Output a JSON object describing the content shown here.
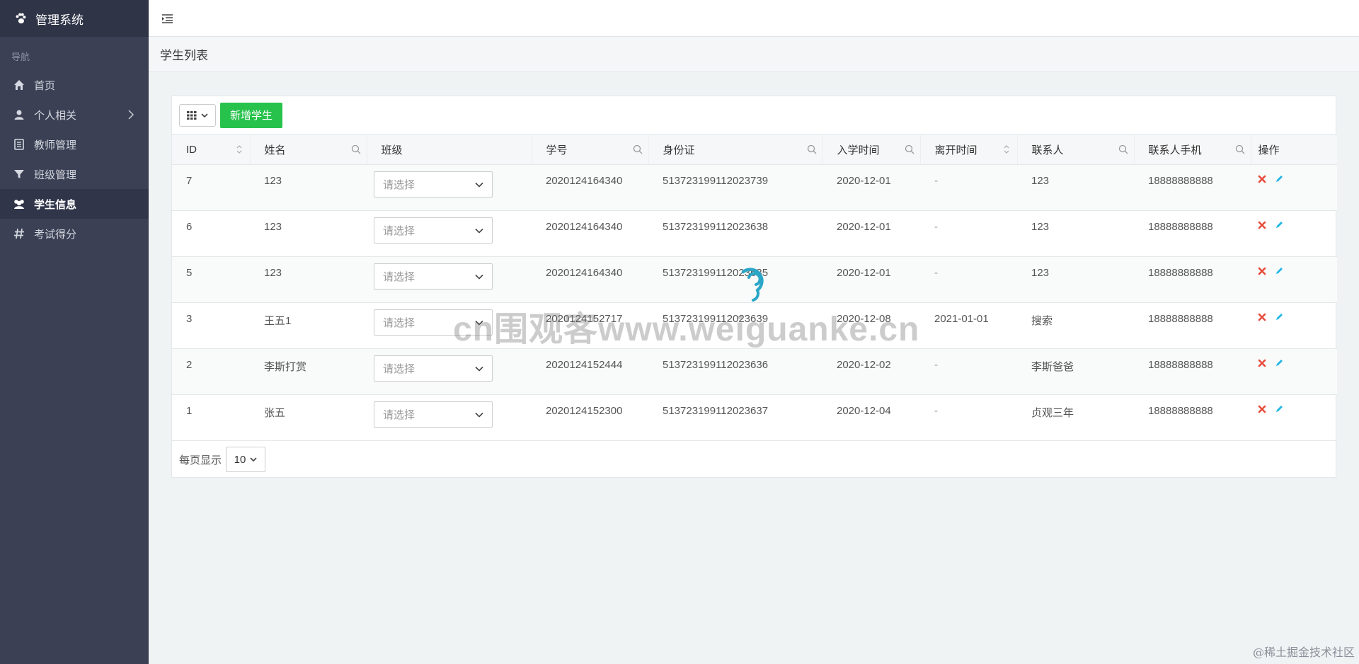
{
  "sidebar": {
    "brand": "管理系统",
    "caption": "导航",
    "items": [
      {
        "label": "首页",
        "icon": "home-icon"
      },
      {
        "label": "个人相关",
        "icon": "user-icon",
        "has_children": true
      },
      {
        "label": "教师管理",
        "icon": "book-icon"
      },
      {
        "label": "班级管理",
        "icon": "filter-icon"
      },
      {
        "label": "学生信息",
        "icon": "users-icon",
        "active": true
      },
      {
        "label": "考试得分",
        "icon": "hash-icon"
      }
    ]
  },
  "page": {
    "title": "学生列表"
  },
  "toolbar": {
    "add_label": "新增学生"
  },
  "table": {
    "columns": [
      "ID",
      "姓名",
      "班级",
      "学号",
      "身份证",
      "入学时间",
      "离开时间",
      "联系人",
      "联系人手机",
      "操作"
    ],
    "select_placeholder": "请选择",
    "rows": [
      {
        "id": "7",
        "name": "123",
        "student_no": "2020124164340",
        "id_card": "513723199112023739",
        "enroll": "2020-12-01",
        "leave": "-",
        "contact": "123",
        "phone": "18888888888"
      },
      {
        "id": "6",
        "name": "123",
        "student_no": "2020124164340",
        "id_card": "513723199112023638",
        "enroll": "2020-12-01",
        "leave": "-",
        "contact": "123",
        "phone": "18888888888"
      },
      {
        "id": "5",
        "name": "123",
        "student_no": "2020124164340",
        "id_card": "513723199112023635",
        "enroll": "2020-12-01",
        "leave": "-",
        "contact": "123",
        "phone": "18888888888"
      },
      {
        "id": "3",
        "name": "王五1",
        "student_no": "2020124152717",
        "id_card": "513723199112023639",
        "enroll": "2020-12-08",
        "leave": "2021-01-01",
        "contact": "搜索",
        "phone": "18888888888"
      },
      {
        "id": "2",
        "name": "李斯打赏",
        "student_no": "2020124152444",
        "id_card": "513723199112023636",
        "enroll": "2020-12-02",
        "leave": "-",
        "contact": "李斯爸爸",
        "phone": "18888888888"
      },
      {
        "id": "1",
        "name": "张五",
        "student_no": "2020124152300",
        "id_card": "513723199112023637",
        "enroll": "2020-12-04",
        "leave": "-",
        "contact": "贞观三年",
        "phone": "18888888888"
      }
    ]
  },
  "pager": {
    "label": "每页显示",
    "page_size": "10"
  },
  "overlay": {
    "watermark": "cn围观客www.weiguanke.cn",
    "credit": "@稀土掘金技术社区"
  },
  "colors": {
    "sidebar": "#3b4054",
    "accent": "#27c24c",
    "delete": "#e74c3c",
    "edit": "#23b7e5"
  }
}
